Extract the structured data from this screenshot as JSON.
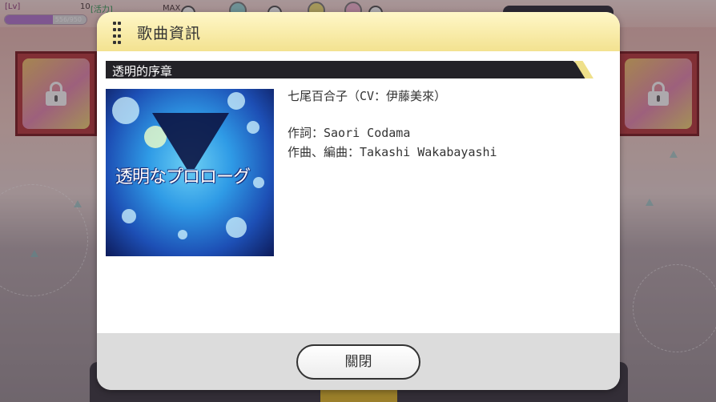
{
  "status_bar": {
    "lv_label": "[Lv]",
    "lv_value": "10",
    "energy_label": "[活力]",
    "exp_text": "556/950",
    "exp_ratio": 0.585,
    "max_label": "MAX"
  },
  "dialog": {
    "title": "歌曲資訊",
    "song_title": "透明的序章",
    "album_art_text": "透明なプロローグ",
    "singer": "七尾百合子（CV：伊藤美來）",
    "lyricist": "作詞：Saori Codama",
    "composer": "作曲、編曲：Takashi Wakabayashi",
    "close_label": "關閉"
  },
  "colors": {
    "header_gradient_top": "#fff7c8",
    "header_gradient_bottom": "#f3e290",
    "song_bar": "#232227",
    "accent_yellow": "#efe08a",
    "footer": "#dcdcdc"
  }
}
